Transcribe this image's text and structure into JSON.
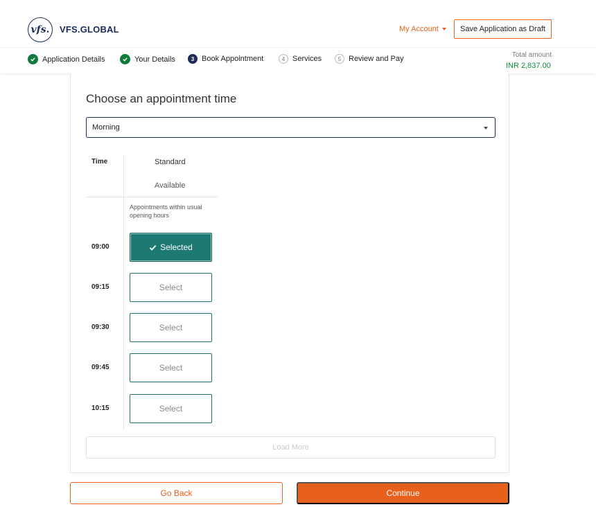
{
  "header": {
    "logo_mark": "vfs.",
    "logo_text": "VFS.GLOBAL",
    "my_account_label": "My Account",
    "save_draft_label": "Save Application as Draft"
  },
  "steps": [
    {
      "label": "Application Details",
      "state": "done"
    },
    {
      "label": "Your Details",
      "state": "done"
    },
    {
      "label": "Book Appointment",
      "state": "active",
      "number": "3"
    },
    {
      "label": "Services",
      "state": "pending",
      "number": "4"
    },
    {
      "label": "Review and Pay",
      "state": "pending",
      "number": "5"
    }
  ],
  "total": {
    "label": "Total amount",
    "value": "INR 2,837.00"
  },
  "booking": {
    "title": "Choose an appointment time",
    "period_select": "Morning",
    "col_time": "Time",
    "col_standard": "Standard",
    "col_available": "Available",
    "note": "Appointments within usual opening hours",
    "slots": [
      {
        "time": "09:00",
        "label": "Selected",
        "selected": true
      },
      {
        "time": "09:15",
        "label": "Select",
        "selected": false
      },
      {
        "time": "09:30",
        "label": "Select",
        "selected": false
      },
      {
        "time": "09:45",
        "label": "Select",
        "selected": false
      },
      {
        "time": "10:15",
        "label": "Select",
        "selected": false
      }
    ],
    "load_more_label": "Load More"
  },
  "footer": {
    "go_back_label": "Go Back",
    "continue_label": "Continue"
  },
  "colors": {
    "accent": "#e8601c",
    "brand_navy": "#1b2b5a",
    "success": "#0f7a3a",
    "slot_selected": "#1d7a72"
  }
}
